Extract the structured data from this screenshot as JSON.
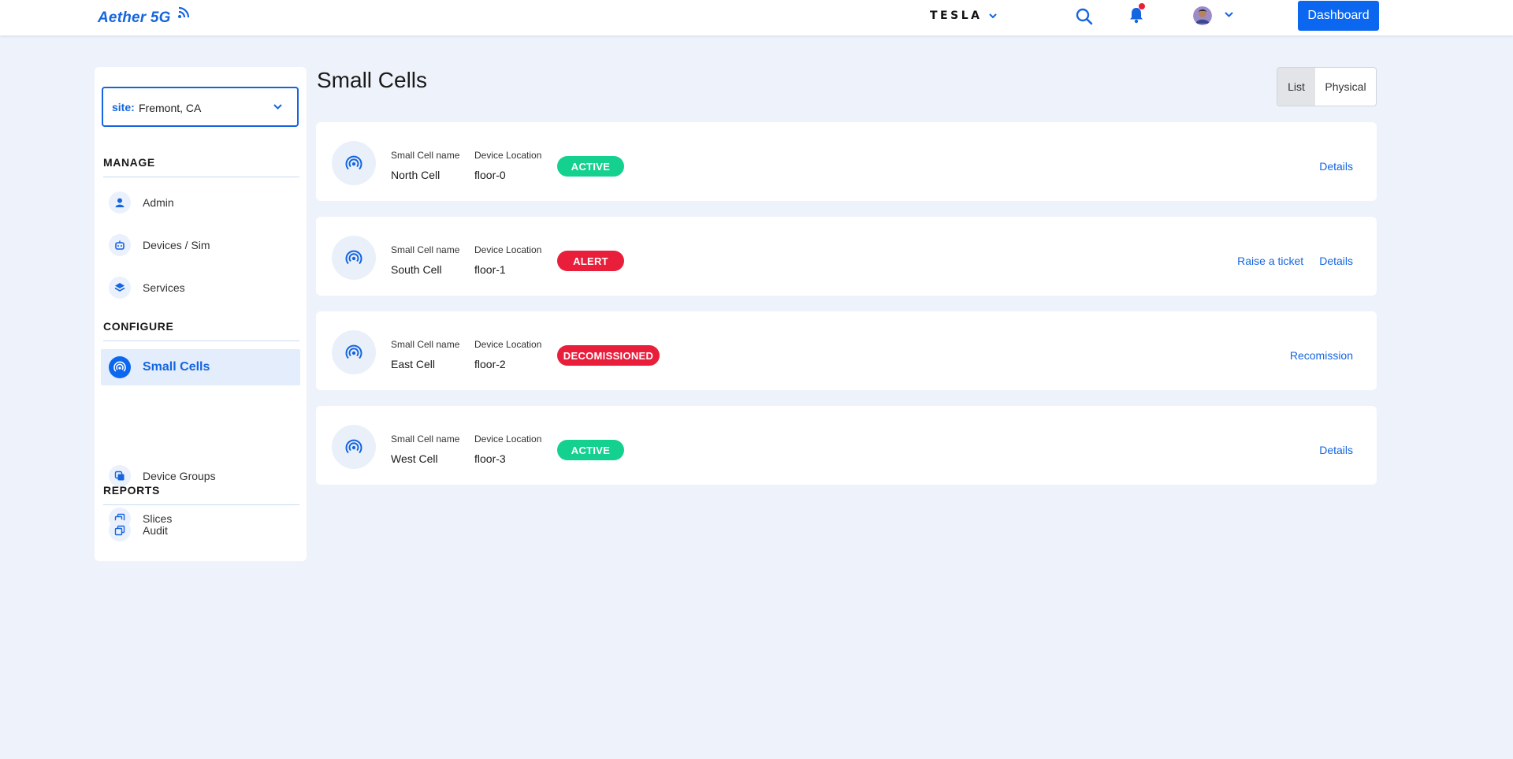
{
  "brand": {
    "name": "Aether 5G",
    "primary_color": "#0b67f0"
  },
  "topbar": {
    "tenant": "TESLA",
    "search_icon": "search-icon",
    "notifications_icon": "bell-icon",
    "has_unread_notifications": true,
    "dashboard_label": "Dashboard"
  },
  "sidebar": {
    "site": {
      "label": "site:",
      "value": "Fremont, CA"
    },
    "sections": [
      {
        "title": "MANAGE",
        "items": [
          {
            "label": "Admin",
            "icon": "user-icon"
          },
          {
            "label": "Devices / Sim",
            "icon": "robot-icon"
          },
          {
            "label": "Services",
            "icon": "layers-icon"
          }
        ]
      },
      {
        "title": "CONFIGURE",
        "items": [
          {
            "label": "Small Cells",
            "icon": "signal-icon",
            "active": true
          },
          {
            "label": "Device Groups",
            "icon": "stack-icon"
          },
          {
            "label": "Slices",
            "icon": "copy-icon"
          }
        ]
      },
      {
        "title": "REPORTS",
        "items": [
          {
            "label": "Audit",
            "icon": "copy-icon"
          }
        ]
      }
    ]
  },
  "main": {
    "title": "Small Cells",
    "view_toggle": {
      "list": "List",
      "physical": "Physical",
      "selected": "List"
    },
    "field_labels": {
      "name": "Small Cell name",
      "location": "Device Location"
    },
    "cells": [
      {
        "name": "North Cell",
        "location": "floor-0",
        "status": "ACTIVE",
        "status_color": "#14d18f",
        "actions": [
          "Details"
        ]
      },
      {
        "name": "South Cell",
        "location": "floor-1",
        "status": "ALERT",
        "status_color": "#e81e3a",
        "actions": [
          "Raise a ticket",
          "Details"
        ]
      },
      {
        "name": "East Cell",
        "location": "floor-2",
        "status": "DECOMISSIONED",
        "status_color": "#e81e3a",
        "actions": [
          "Recomission"
        ]
      },
      {
        "name": "West Cell",
        "location": "floor-3",
        "status": "ACTIVE",
        "status_color": "#14d18f",
        "actions": [
          "Details"
        ]
      }
    ]
  }
}
